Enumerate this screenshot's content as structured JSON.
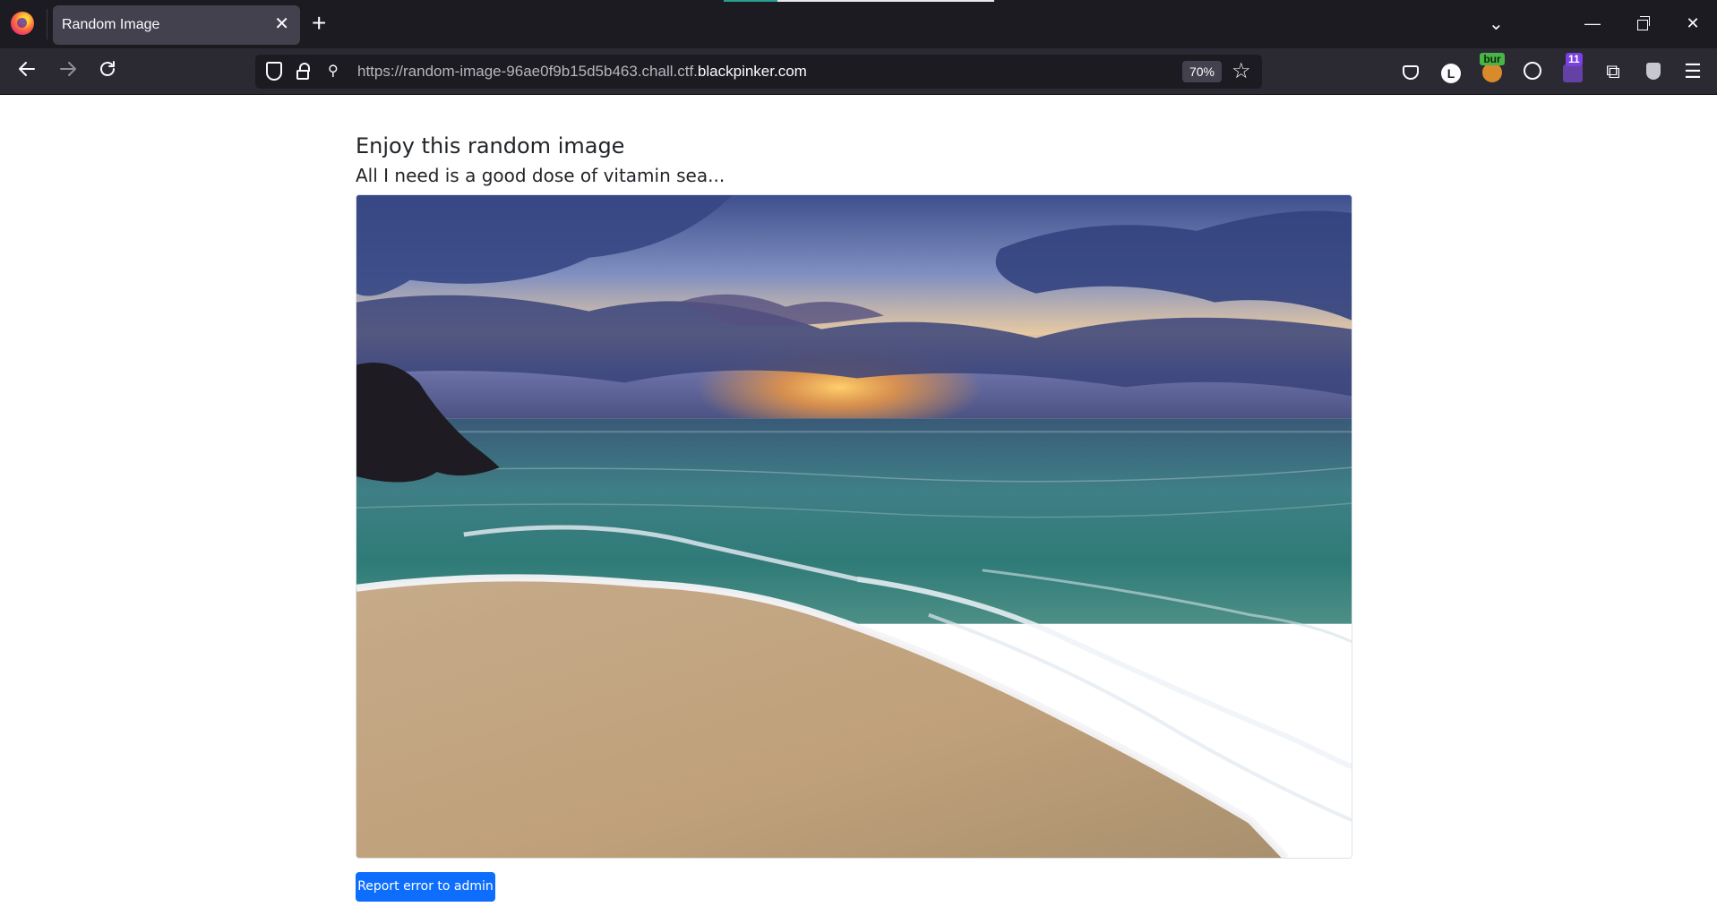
{
  "browser": {
    "tab_title": "Random Image",
    "tab_close_glyph": "✕",
    "new_tab_glyph": "+",
    "url_prefix": "https://random-image-96ae0f9b15d5b463.chall.ctf.",
    "url_domain": "blackpinker.com",
    "zoom": "70%",
    "account_initial": "L",
    "burp_label": "bur",
    "twitch_badge": "11",
    "window_min_glyph": "—",
    "window_close_glyph": "✕",
    "icons": {
      "back": "arrow-left-icon",
      "forward": "arrow-right-icon",
      "reload": "reload-icon",
      "star": "star-icon",
      "menu": "hamburger-menu-icon"
    }
  },
  "page": {
    "title": "Enjoy this random image",
    "subtitle": "All I need is a good dose of vitamin sea...",
    "report_button": "Report error to admin",
    "button_color": "#0d6efd"
  }
}
